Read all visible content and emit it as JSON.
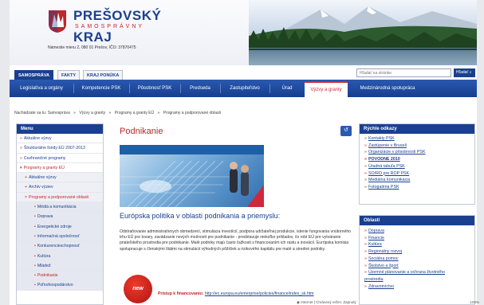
{
  "header": {
    "logo_line1": "PREŠOVSKÝ",
    "logo_line2": "SAMOSPRÁVNY",
    "logo_line3": "KRAJ",
    "address": "Námestie mieru 2, 080 01 Prešov, IČO: 37870475"
  },
  "tabs": [
    "SAMOSPRÁVA",
    "FAKTY",
    "KRAJ PONÚKA"
  ],
  "search": {
    "placeholder": "Hľadať na stránke",
    "button": "Hľadať"
  },
  "nav": [
    "Legislatíva a orgány",
    "Kompetencie PSK",
    "Pôsobnosť PSK",
    "Predseda",
    "Zastupiteľstvo",
    "Úrad",
    "Výzvy a granty",
    "Medzinárodná spolupráca"
  ],
  "breadcrumb": [
    "Nachádzate sa tu: Samospráva",
    "»",
    "Výzvy a granty",
    "»",
    "Programy a granty EÚ",
    "»",
    "Programy a podporované oblasti"
  ],
  "menu": {
    "title": "Menu",
    "items": [
      {
        "label": "Aktuálne výzvy",
        "mark": "»"
      },
      {
        "label": "Štrukturálne fondy EÚ 2007-2013",
        "mark": "»"
      },
      {
        "label": "Cezhraničné programy",
        "mark": "»"
      },
      {
        "label": "Programy a granty EÚ",
        "mark": "▾"
      },
      {
        "label": "Aktuálne výzvy",
        "mark": "+"
      },
      {
        "label": "Archív výziev",
        "mark": "+"
      },
      {
        "label": "Programy a podporované oblasti",
        "mark": "×"
      },
      {
        "label": "Médiá a komunikácia",
        "mark": "•"
      },
      {
        "label": "Doprava",
        "mark": "•"
      },
      {
        "label": "Energetické zdroje",
        "mark": "•"
      },
      {
        "label": "Informačná spoločnosť",
        "mark": "•"
      },
      {
        "label": "Konkurencieschopnosť",
        "mark": "•"
      },
      {
        "label": "Kultúra",
        "mark": "•"
      },
      {
        "label": "Mládež",
        "mark": "•"
      },
      {
        "label": "Podnikanie",
        "mark": "•"
      },
      {
        "label": "Poľnohospodárstvo",
        "mark": "•"
      }
    ]
  },
  "main": {
    "title": "Podnikanie",
    "back": "↺",
    "section_title": "Európska politika v oblasti podnikania a priemyslu:",
    "paragraph": "Odstraňovanie administratívnych obmedzení, stimulácia investícií, podpora udržateľnej produkcie, istenie fungovania vnútorného trhu EÚ pre tovary, zavádzanie nových možností pre podnikanie - predstavuje niekoľko príkladov, čo robí EÚ pre vytváranie priateľského prostredia pre podnikanie. Malé podniky majú často ťažkosti s financovaním ich rastu a inovácií. Európska komisia spolupracuje s členskými štátmi na stimulácii výhodných pôžičiek a rizikového kapitálu pre malé a stredné podniky.",
    "badge": "new",
    "link_label": "Prístup k financovaniu:",
    "link_url": "http://ec.europa.eu/enterprise/policies/finance/index_sk.htm"
  },
  "quick_links": {
    "title": "Rýchle odkazy",
    "items": [
      {
        "label": "Kontakty PSK",
        "bold": false
      },
      {
        "label": "Zastúpenie v Bruseli",
        "bold": false
      },
      {
        "label": "Organizácie v pôsobnosti PSK",
        "bold": false
      },
      {
        "label": "POVODNE 2010",
        "bold": true
      },
      {
        "label": "Úradná tabuľa PSK",
        "bold": false
      },
      {
        "label": "SO/RO pre ROP PSK",
        "bold": false
      },
      {
        "label": "Mediálna komunikácia",
        "bold": false
      },
      {
        "label": "Fotogaléria PSK",
        "bold": false
      }
    ]
  },
  "areas": {
    "title": "Oblasti",
    "items": [
      "Doprava",
      "Financie",
      "Kultúra",
      "Regionálny rozvoj",
      "Sociálna pomoc",
      "Školstvo a šport",
      "Územné plánovanie a ochrana životného prostredia",
      "Zdravotníctvo"
    ]
  },
  "status": {
    "zone": "Internet | Chránený režim: Zapnutý",
    "zoom": "100%"
  },
  "colors": {
    "brand": "#1a3f8f",
    "accent": "#c0262c",
    "nav": "#1f4a9e"
  }
}
